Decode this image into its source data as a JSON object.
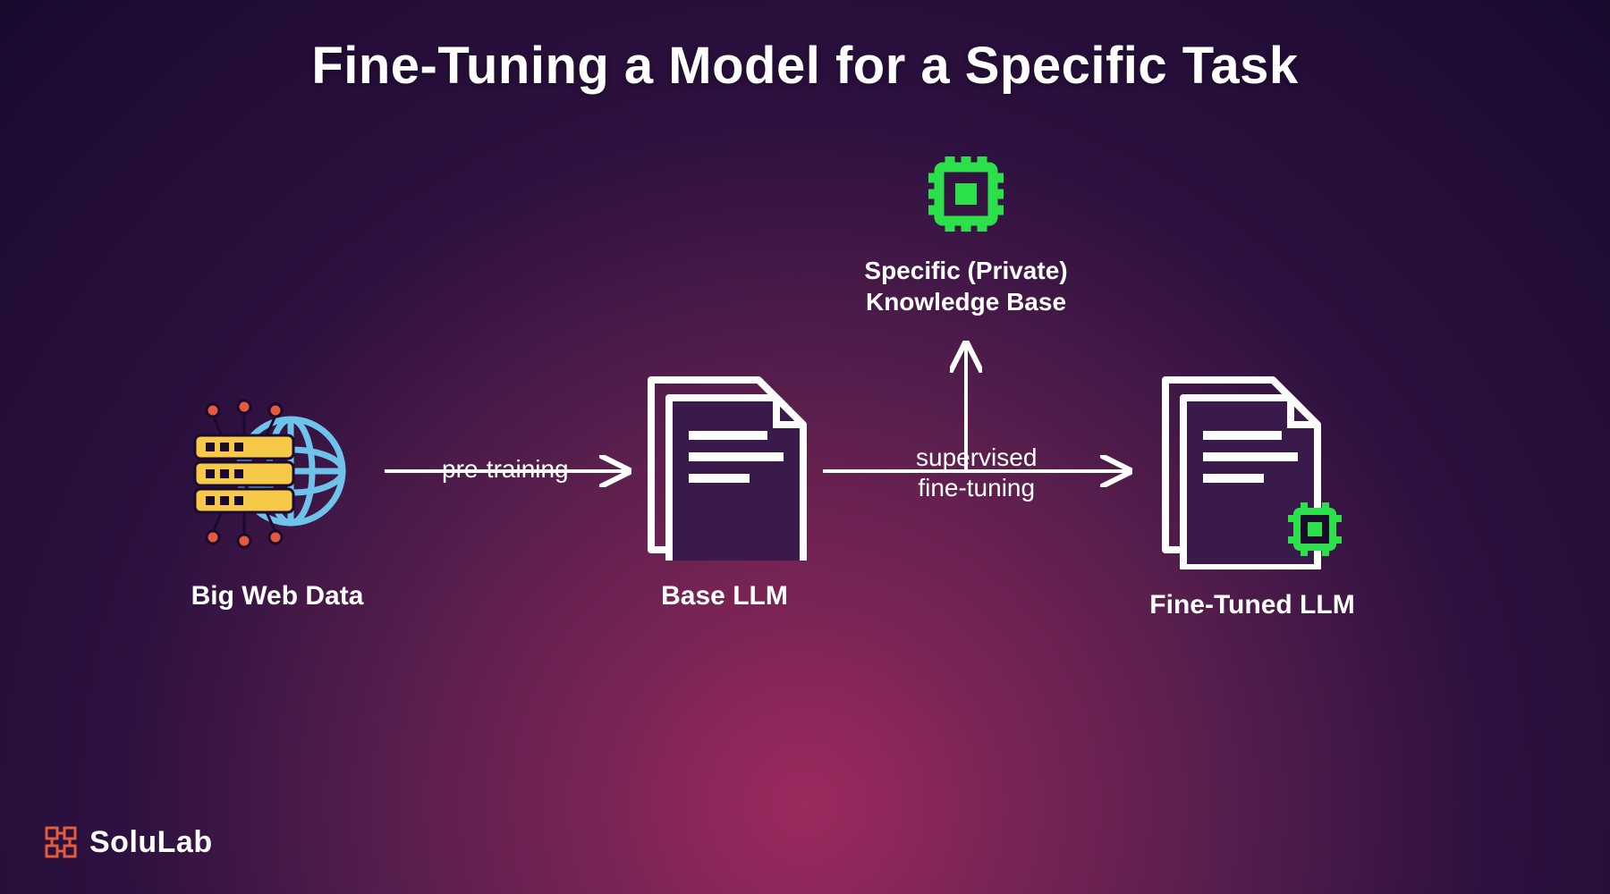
{
  "title": "Fine-Tuning a Model for a Specific Task",
  "nodes": {
    "webdata": {
      "label": "Big Web Data"
    },
    "basellm": {
      "label": "Base LLM"
    },
    "ftllm": {
      "label": "Fine-Tuned LLM"
    },
    "kb": {
      "label_line1": "Specific (Private)",
      "label_line2": "Knowledge Base"
    }
  },
  "arrows": {
    "pretrain": {
      "label": "pre-training"
    },
    "sft": {
      "label_line1": "supervised",
      "label_line2": "fine-tuning"
    }
  },
  "brand": {
    "name": "SoluLab"
  },
  "colors": {
    "accent_green": "#2be04a",
    "accent_yellow": "#f6c948",
    "accent_red": "#e35a3e",
    "accent_blue": "#6fc3ea",
    "white": "#ffffff"
  }
}
